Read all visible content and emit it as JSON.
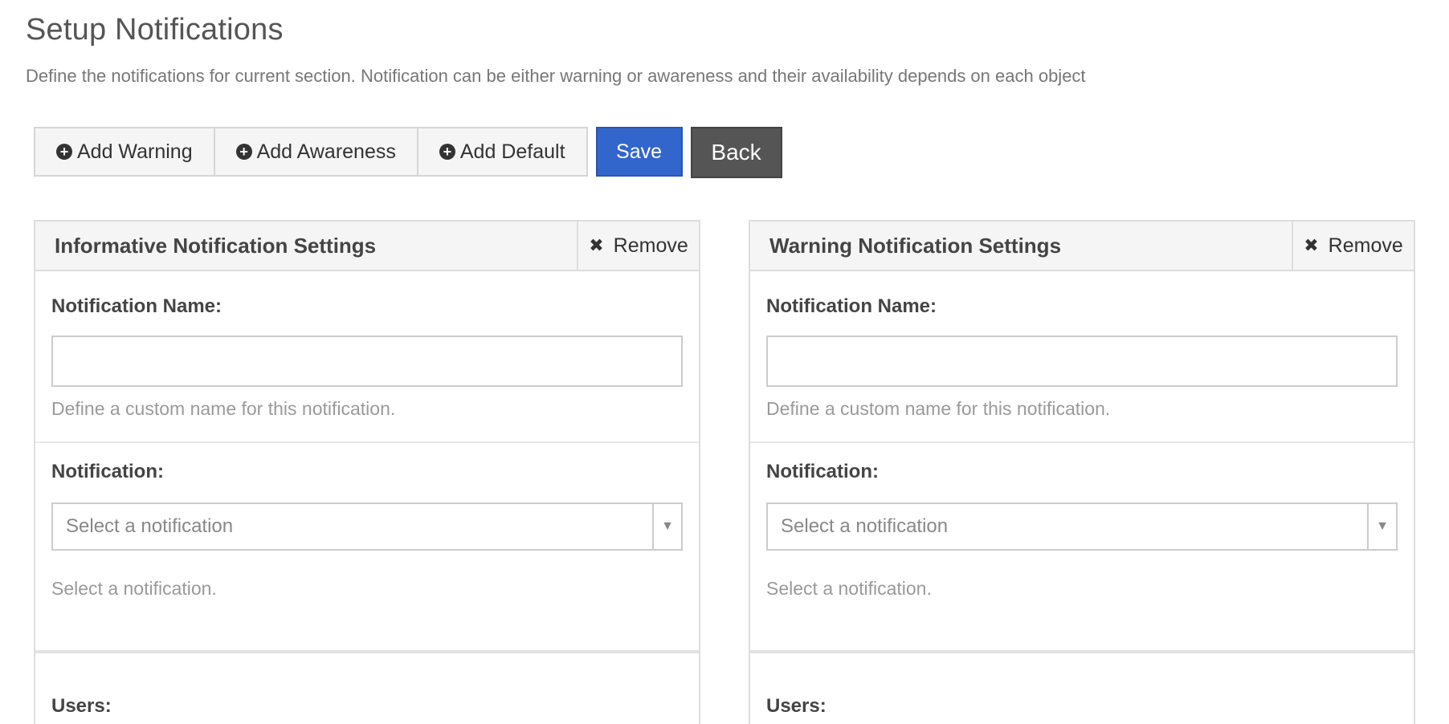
{
  "header": {
    "title": "Setup Notifications",
    "description": "Define the notifications for current section. Notification can be either warning or awareness and their availability depends on each object"
  },
  "toolbar": {
    "add_warning": "Add Warning",
    "add_awareness": "Add Awareness",
    "add_default": "Add Default",
    "save": "Save",
    "back": "Back"
  },
  "panels": [
    {
      "title": "Informative Notification Settings",
      "remove": "Remove",
      "name_label": "Notification Name:",
      "name_value": "",
      "name_help": "Define a custom name for this notification.",
      "notification_label": "Notification:",
      "notification_select": "Select a notification",
      "notification_help": "Select a notification.",
      "users_label": "Users:"
    },
    {
      "title": "Warning Notification Settings",
      "remove": "Remove",
      "name_label": "Notification Name:",
      "name_value": "",
      "name_help": "Define a custom name for this notification.",
      "notification_label": "Notification:",
      "notification_select": "Select a notification",
      "notification_help": "Select a notification.",
      "users_label": "Users:"
    }
  ],
  "colors": {
    "save_button": "#3366cc",
    "back_button": "#555555",
    "panel_header": "#f5f5f5"
  },
  "icons": {
    "add": "plus-circle-icon",
    "remove": "close-icon",
    "select": "chevron-down-icon"
  }
}
